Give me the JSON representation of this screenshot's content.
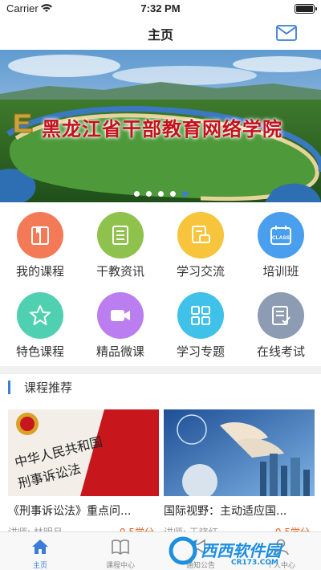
{
  "status_bar": {
    "carrier": "Carrier",
    "time": "7:32 PM"
  },
  "nav": {
    "title": "主页"
  },
  "banner": {
    "title": "黑龙江省干部教育网络学院",
    "slide_count": 5,
    "active_slide": 5
  },
  "grid": [
    {
      "label": "我的课程",
      "icon": "book-icon",
      "color": "#f47a57"
    },
    {
      "label": "干教资讯",
      "icon": "newspaper-icon",
      "color": "#8fc24d"
    },
    {
      "label": "学习交流",
      "icon": "chat-document-icon",
      "color": "#f7c43b"
    },
    {
      "label": "培训班",
      "icon": "calendar-class-icon",
      "color": "#4a9eee"
    },
    {
      "label": "特色课程",
      "icon": "star-icon",
      "color": "#4fd0b0"
    },
    {
      "label": "精品微课",
      "icon": "video-camera-icon",
      "color": "#ba7ef0"
    },
    {
      "label": "学习专题",
      "icon": "grid-icon",
      "color": "#3fc1e9"
    },
    {
      "label": "在线考试",
      "icon": "exam-list-icon",
      "color": "#8d9bb3"
    }
  ],
  "section": {
    "title": "课程推荐"
  },
  "courses": [
    {
      "title": "《刑事诉讼法》重点问...",
      "meta_left": "讲师: 林明月",
      "meta_right": "0.5学分"
    },
    {
      "title": "国际视野：主动适应国...",
      "meta_left": "讲师: 王晓红",
      "meta_right": "0.5学分"
    }
  ],
  "tabs": [
    {
      "label": "主页",
      "icon": "home-icon",
      "active": true
    },
    {
      "label": "课程中心",
      "icon": "open-book-icon",
      "active": false
    },
    {
      "label": "通知公告",
      "icon": "megaphone-icon",
      "active": false
    },
    {
      "label": "个人中心",
      "icon": "person-icon",
      "active": false
    }
  ],
  "watermark": {
    "text": "西西软件园",
    "sub": "CR173.COM"
  },
  "colors": {
    "accent": "#3b7dd8",
    "score": "#e8611a"
  }
}
